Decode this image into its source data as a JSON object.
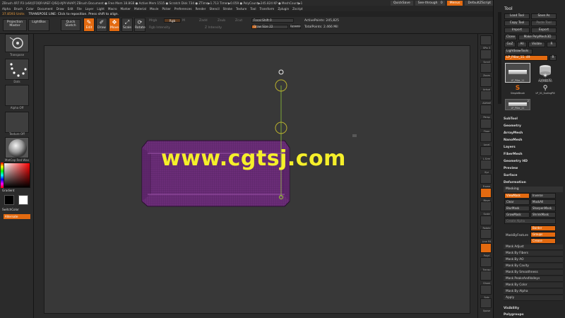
{
  "titlebar": {
    "text": "ZBrush 4R7 P3 (x64)[FOQR-VAEF-QISQ-AJPI-VHAP]   ZBrush Document      ● Free Mem 18.8GB ● Active Mem 1515 ● Scratch Disk 734 ● ZTime▶1.713 Timer▶0.059 ● PolyCount▶245.824 KP ● MeshCount▶1",
    "quicksave": "QuickSave",
    "seethrough": "See-through",
    "seethrough_value": "0",
    "menus": "Menus",
    "script": "DefaultZScript"
  },
  "menubar": {
    "items": [
      "Alpha",
      "Brush",
      "Color",
      "Document",
      "Draw",
      "Edit",
      "File",
      "Layer",
      "Light",
      "Macro",
      "Marker",
      "Material",
      "Movie",
      "Picker",
      "Preferences",
      "Render",
      "Stencil",
      "Stroke",
      "Texture",
      "Tool",
      "Transform",
      "Zplugin",
      "Zscript"
    ]
  },
  "status": {
    "units": "37.8593 Units",
    "message": "TRANSPOSE LINE: Click to reposition. Press shift to align."
  },
  "shelf": {
    "projection_master": "Projection Master",
    "lightbox": "LightBox",
    "quick_sketch": "Quick Sketch",
    "edit": "Edit",
    "draw": "Draw",
    "move": "Move",
    "scale": "Scale",
    "rotate": "Rotate",
    "mrgb": "Mrgb",
    "rgb": "Rgb",
    "m": "M",
    "rgb_intensity": "Rgb Intensity",
    "zadd": "Zadd",
    "zsub": "Zsub",
    "zcut": "Zcut",
    "z_intensity": "Z Intensity",
    "focal_shift_label": "Focal Shift 0",
    "draw_size_label": "Draw Size 22",
    "dynamic": "Dynamic",
    "active_points": "ActivePoints: 245,825",
    "total_points": "TotalPoints: 2.466 Mil"
  },
  "left": {
    "brush_label": "Transpose",
    "stroke_label": "Dots",
    "alpha_label": "Alpha Off",
    "texture_label": "Texture Off",
    "material_label": "MatCap Red Wax",
    "gradient": "Gradient",
    "switchcolor": "SwitchColor",
    "alternate": "Alternate"
  },
  "rightcol": {
    "labels": [
      "SPix 3",
      "Scroll",
      "Zoom",
      "Actual",
      "AAHalf",
      "Persp",
      "Floor",
      "Local",
      "L.Sym",
      "Xyz",
      "Frame",
      "Move",
      "Scale",
      "Rotate",
      "Line Fill",
      "Polyf",
      "Transp",
      "Ghost",
      "Solo",
      "Xpose"
    ]
  },
  "tool": {
    "title": "Tool",
    "load_tool": "Load Tool",
    "save_as": "Save As",
    "copy_tool": "Copy Tool",
    "paste_tool": "Paste Tool",
    "import": "Import",
    "export": "Export",
    "clone": "Clone",
    "make_polymesh": "Make PolyMesh3D",
    "goz": "GoZ",
    "all": "All",
    "visible": "Visible",
    "r": "R",
    "lightbox_tools": "Lightbox▸Tools",
    "current_tool": "LP_Pillar_11. 49",
    "r2": "R",
    "thumbs": [
      "LP_Pillar_11",
      "Cylinder3D",
      "PolyMesh3D",
      "SimpleBrush",
      "LP_01_ScalingPill",
      "LP_Pillar_11"
    ],
    "thumb_num": "2",
    "sections": [
      "SubTool",
      "Geometry",
      "ArrayMesh",
      "NanoMesh",
      "Layers",
      "FiberMesh",
      "Geometry HD",
      "Preview",
      "Surface",
      "Deformation"
    ],
    "masking": "Masking",
    "viewmask": "ViewMask",
    "inverse": "Inverse",
    "clear": "Clear",
    "maskall": "MaskAll",
    "blurmask": "BlurMask",
    "sharpenmask": "SharpenMask",
    "growmask": "GrowMask",
    "shrinkmask": "ShrinkMask",
    "create_alpha": "Create Alpha",
    "maskbyfeature": "MaskByFeature",
    "border": "Border",
    "groups": "Groups",
    "crease": "Crease",
    "mask_items": [
      "Mask Adjust",
      "Mask By Fibers",
      "Mask By AO",
      "Mask By Cavity",
      "Mask By Smoothness",
      "Mask PeaksAndValleys",
      "Mask By Color",
      "Mask By Alpha",
      "Apply"
    ],
    "bottom_sections": [
      "Visibility",
      "Polygroups"
    ]
  },
  "watermark": "www.cgtsj.com",
  "colors": {
    "accent": "#e36a10",
    "mesh_purple": "#6b2d78",
    "watermark": "#f5ef2a",
    "transpose_green": "#9acd32"
  }
}
